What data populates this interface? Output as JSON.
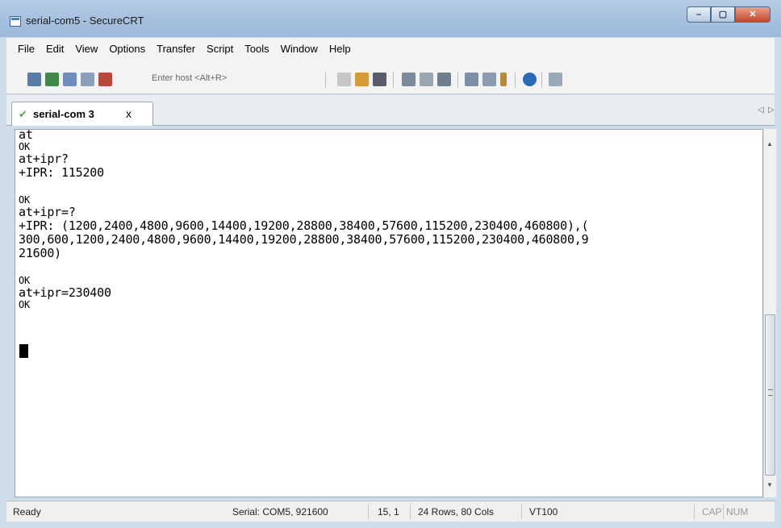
{
  "window": {
    "title": "serial-com5 - SecureCRT"
  },
  "menu": [
    "File",
    "Edit",
    "View",
    "Options",
    "Transfer",
    "Script",
    "Tools",
    "Window",
    "Help"
  ],
  "toolbar": {
    "host_placeholder": "Enter host <Alt+R>"
  },
  "tab": {
    "label": "serial-com 3",
    "close": "x"
  },
  "terminal": {
    "lines": [
      "at",
      "OK",
      "at+ipr?",
      "+IPR: 115200",
      "",
      "OK",
      "at+ipr=?",
      "+IPR: (1200,2400,4800,9600,14400,19200,28800,38400,57600,115200,230400,460800),(",
      "300,600,1200,2400,4800,9600,14400,19200,28800,38400,57600,115200,230400,460800,9",
      "21600)",
      "",
      "OK",
      "at+ipr=230400",
      "OK"
    ]
  },
  "status": {
    "ready": "Ready",
    "serial": "Serial: COM5, 921600",
    "position": "15,  1",
    "size": "24 Rows, 80 Cols",
    "emulation": "VT100",
    "caps": "CAP",
    "num": "NUM"
  }
}
